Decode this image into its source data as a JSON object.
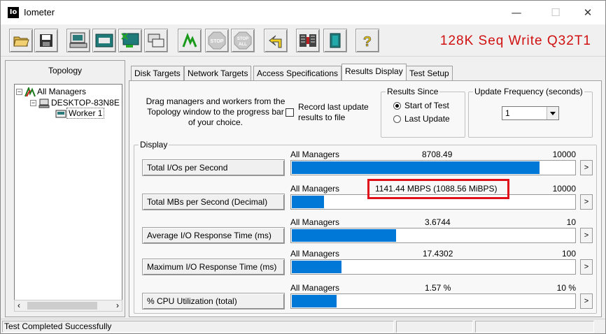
{
  "window": {
    "title": "Iometer",
    "app_icon_text": "Io",
    "minimize": "—",
    "maximize": "☐",
    "close": "✕"
  },
  "toolbar": {
    "items": [
      {
        "name": "open-config-icon"
      },
      {
        "name": "save-config-icon"
      },
      {
        "name": "new-disk-worker-icon"
      },
      {
        "name": "new-network-worker-icon"
      },
      {
        "name": "add-network-worker-icon"
      },
      {
        "name": "duplicate-worker-icon"
      },
      {
        "name": "start-tests-icon"
      },
      {
        "name": "stop-test-icon",
        "text": "STOP"
      },
      {
        "name": "stop-all-icon",
        "text": "STOP ALL"
      },
      {
        "name": "reset-workers-icon"
      },
      {
        "name": "disconnect-managers-icon"
      },
      {
        "name": "exit-icon"
      },
      {
        "name": "help-icon",
        "text": "?"
      }
    ],
    "benchmark_title": "128K Seq Write Q32T1"
  },
  "topology": {
    "label": "Topology",
    "tree": [
      {
        "label": "All Managers",
        "level": 0,
        "toggle": "−"
      },
      {
        "label": "DESKTOP-83N8E",
        "level": 1,
        "toggle": "−"
      },
      {
        "label": "Worker 1",
        "level": 2,
        "toggle": ""
      }
    ],
    "scroll_left": "‹",
    "scroll_right": "›"
  },
  "tabs": [
    "Disk Targets",
    "Network Targets",
    "Access Specifications",
    "Results Display",
    "Test Setup"
  ],
  "active_tab": "Results Display",
  "results": {
    "drag_hint": "Drag managers and workers from the Topology window to the progress bar of your choice.",
    "record_label": "Record last update results to file",
    "record_checked": false,
    "results_since": {
      "title": "Results Since",
      "options": [
        "Start of Test",
        "Last Update"
      ],
      "selected": "Start of Test"
    },
    "update_frequency": {
      "title": "Update Frequency (seconds)",
      "value": "1"
    },
    "display_title": "Display",
    "metrics": [
      {
        "button": "Total I/Os per Second",
        "manager": "All Managers",
        "value": "8708.49",
        "max": "10000",
        "fraction": 0.8708
      },
      {
        "button": "Total MBs per Second (Decimal)",
        "manager": "All Managers",
        "value": "1141.44 MBPS (1088.56 MiBPS)",
        "max": "10000",
        "fraction": 0.1141
      },
      {
        "button": "Average I/O Response Time (ms)",
        "manager": "All Managers",
        "value": "3.6744",
        "max": "10",
        "fraction": 0.3674
      },
      {
        "button": "Maximum I/O Response Time (ms)",
        "manager": "All Managers",
        "value": "17.4302",
        "max": "100",
        "fraction": 0.1743
      },
      {
        "button": "% CPU Utilization (total)",
        "manager": "All Managers",
        "value": "1.57 %",
        "max": "10 %",
        "fraction": 0.157
      }
    ],
    "arrow": ">"
  },
  "status": {
    "text": "Test Completed Successfully"
  },
  "colors": {
    "bar": "#0078d7",
    "highlight": "#e0101a",
    "title_red": "#d01010"
  }
}
